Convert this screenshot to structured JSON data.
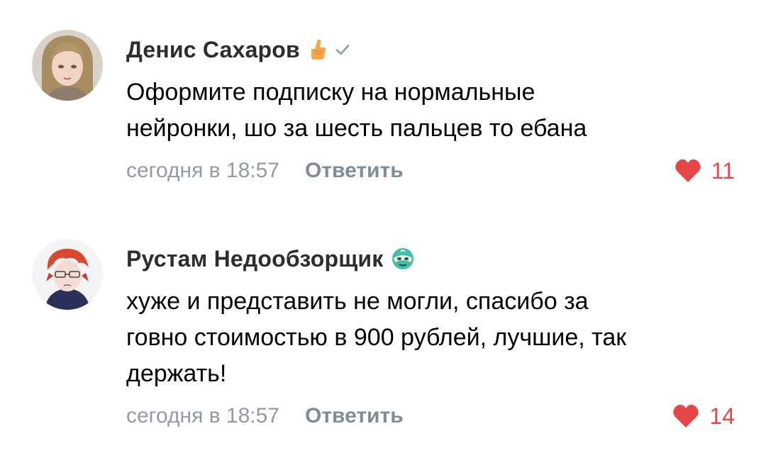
{
  "comments": [
    {
      "author": "Денис Сахаров",
      "badges": [
        "thumbs-up-icon",
        "verified-check-icon"
      ],
      "text": "Оформите подписку на нормальные\nнейронки, шо за шесть пальцев то ебана",
      "time": "сегодня в 18:57",
      "reply_label": "Ответить",
      "likes": "11"
    },
    {
      "author": "Рустам Недообзорщик",
      "badges": [
        "mask-emoji-icon"
      ],
      "text": "хуже и представить не могли, спасибо за\nговно стоимостью в 900 рублей, лучшие, так\nдержать!",
      "time": "сегодня в 18:57",
      "reply_label": "Ответить",
      "likes": "14"
    }
  ],
  "colors": {
    "author": "#2c2d2e",
    "meta": "#939aa3",
    "reply": "#818c99",
    "like": "#e64646"
  }
}
